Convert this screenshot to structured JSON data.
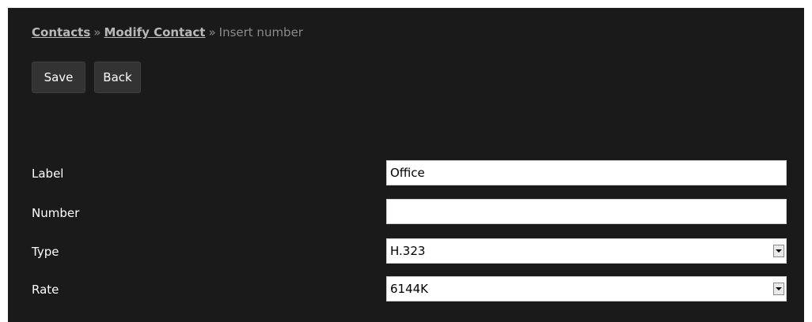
{
  "breadcrumb": {
    "items": [
      "Contacts",
      "Modify Contact"
    ],
    "separator": "»",
    "current": "Insert number"
  },
  "toolbar": {
    "save_label": "Save",
    "back_label": "Back"
  },
  "form": {
    "label": {
      "label": "Label",
      "value": "Office"
    },
    "number": {
      "label": "Number",
      "value": ""
    },
    "type": {
      "label": "Type",
      "value": "H.323"
    },
    "rate": {
      "label": "Rate",
      "value": "6144K"
    }
  }
}
